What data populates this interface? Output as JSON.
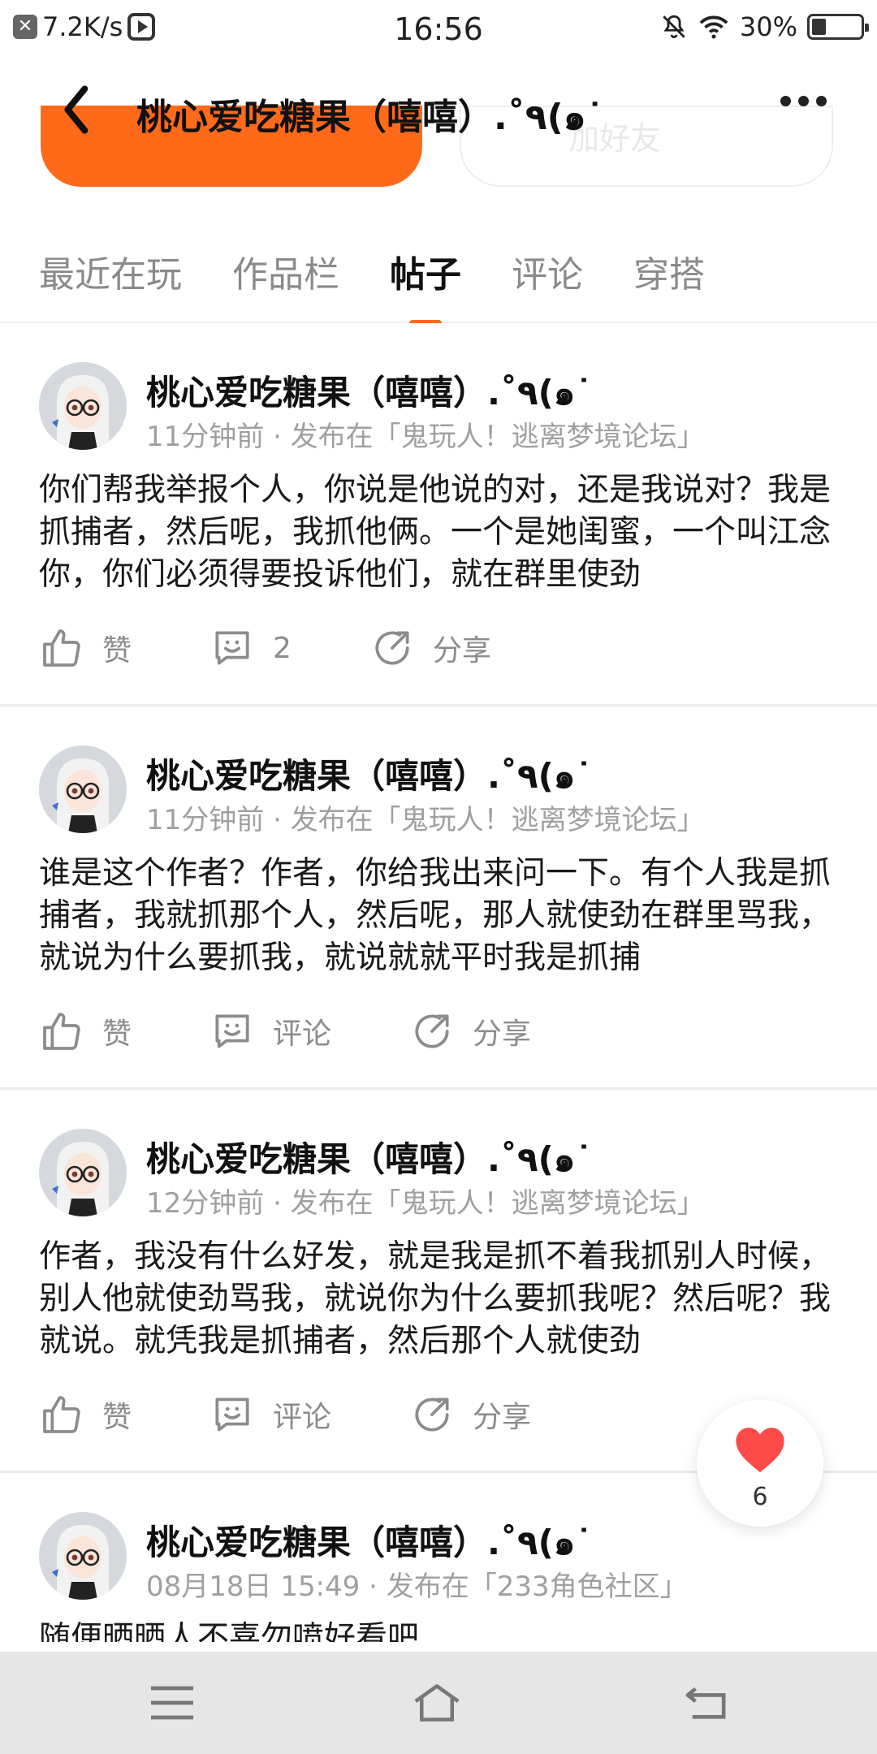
{
  "status_bar": {
    "speed": "7.2K/s",
    "time": "16:56",
    "battery": "30%",
    "battery_level": 0.3
  },
  "header": {
    "title": "桃心爱吃糖果（嘻嘻）.˚٩(๑˙",
    "background_button": "加好友"
  },
  "tabs": [
    {
      "label": "最近在玩",
      "active": false
    },
    {
      "label": "作品栏",
      "active": false
    },
    {
      "label": "帖子",
      "active": true
    },
    {
      "label": "评论",
      "active": false
    },
    {
      "label": "穿搭",
      "active": false
    }
  ],
  "posts": [
    {
      "author": "桃心爱吃糖果（嘻嘻）.˚٩(๑˙",
      "meta": "11分钟前 · 发布在「鬼玩人！逃离梦境论坛」",
      "text": "你们帮我举报个人，你说是他说的对，还是我说对？我是抓捕者，然后呢，我抓他俩。一个是她闺蜜，一个叫江念你，你们必须得要投诉他们，就在群里使劲",
      "like_label": "赞",
      "comment_label": "2",
      "share_label": "分享"
    },
    {
      "author": "桃心爱吃糖果（嘻嘻）.˚٩(๑˙",
      "meta": "11分钟前 · 发布在「鬼玩人！逃离梦境论坛」",
      "text": "谁是这个作者？作者，你给我出来问一下。有个人我是抓捕者，我就抓那个人，然后呢，那人就使劲在群里骂我，就说为什么要抓我，就说就就平时我是抓捕",
      "like_label": "赞",
      "comment_label": "评论",
      "share_label": "分享"
    },
    {
      "author": "桃心爱吃糖果（嘻嘻）.˚٩(๑˙",
      "meta": "12分钟前 · 发布在「鬼玩人！逃离梦境论坛」",
      "text": "作者，我没有什么好发，就是我是抓不着我抓别人时候，别人他就使劲骂我，就说你为什么要抓我呢？然后呢？我就说。就凭我是抓捕者，然后那个人就使劲",
      "like_label": "赞",
      "comment_label": "评论",
      "share_label": "分享"
    },
    {
      "author": "桃心爱吃糖果（嘻嘻）.˚٩(๑˙",
      "meta": "08月18日 15:49 · 发布在「233角色社区」",
      "text": "随便晒晒人不喜勿喷好看吧"
    }
  ],
  "float_like": {
    "count": "6",
    "color": "#ff4a4a"
  },
  "colors": {
    "accent": "#ff6a1a",
    "muted": "#8c8c8c"
  },
  "icons": {
    "back": "chevron-left-icon",
    "more": "more-horizontal-icon",
    "like": "thumbs-up-icon",
    "comment": "comment-smile-icon",
    "share": "share-arrow-icon",
    "heart": "heart-icon",
    "nav_menu": "menu-icon",
    "nav_home": "home-icon",
    "nav_back": "return-icon"
  }
}
